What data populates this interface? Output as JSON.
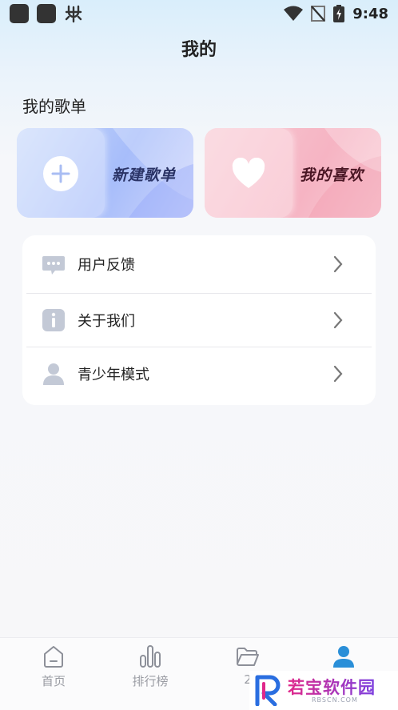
{
  "status_bar": {
    "time": "9:48"
  },
  "header": {
    "title": "我的"
  },
  "playlists": {
    "section_title": "我的歌单",
    "new_playlist_label": "新建歌单",
    "favorites_label": "我的喜欢"
  },
  "menu": {
    "items": [
      {
        "label": "用户反馈",
        "icon": "feedback-icon"
      },
      {
        "label": "关于我们",
        "icon": "info-icon"
      },
      {
        "label": "青少年模式",
        "icon": "user-icon"
      }
    ]
  },
  "tabbar": {
    "tabs": [
      {
        "label": "首页",
        "icon": "home-icon"
      },
      {
        "label": "排行榜",
        "icon": "chart-icon"
      },
      {
        "label": "2",
        "icon": "folder-icon"
      },
      {
        "label": "",
        "icon": "profile-icon",
        "active": true
      }
    ]
  },
  "watermark": {
    "text": "若宝软件园",
    "sub": "RBSCN.COM"
  },
  "colors": {
    "accent": "#2a8fd8",
    "icon_gray": "#c3c9d6"
  }
}
